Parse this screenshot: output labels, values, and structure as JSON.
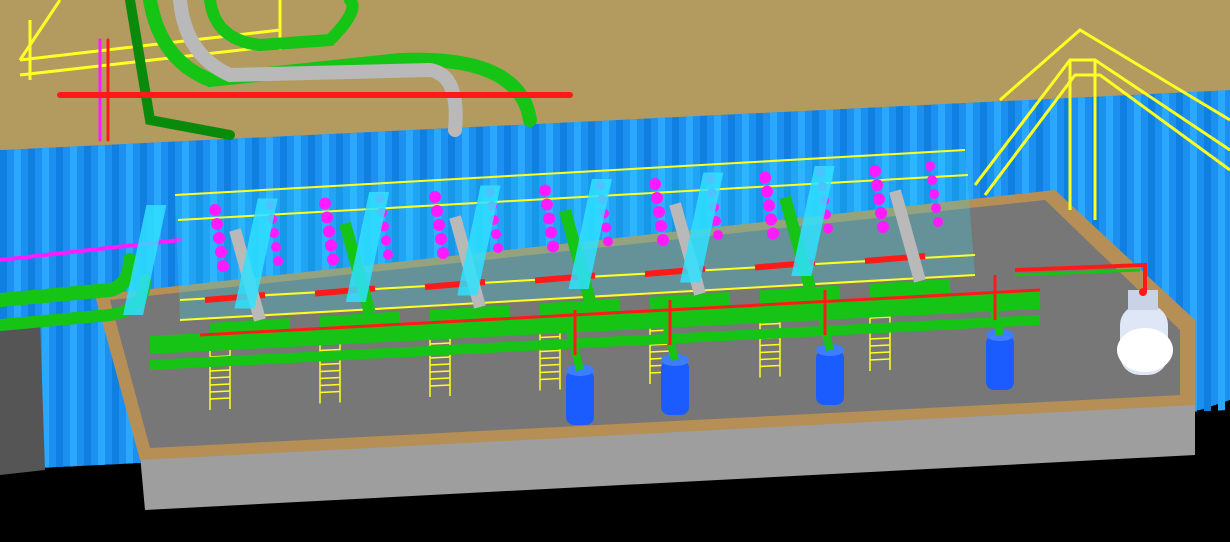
{
  "scene": {
    "description_free": true,
    "colors": {
      "ground": "#b39a5f",
      "water_light": "#2aa8ff",
      "water_dark": "#0f7fe0",
      "basin_floor": "#7a7a7a",
      "basin_wall": "#a0a0a0",
      "basin_rim": "#b58f55",
      "pipe_green": "#15c415",
      "pipe_dark_green": "#0a8a0a",
      "pipe_grey": "#b9b9b9",
      "pipe_red": "#ff1a1a",
      "pipe_magenta": "#ff1aff",
      "pipe_cyan": "#2fe0ff",
      "walkway_yellow": "#ffff22",
      "pump_blue": "#1a5cff",
      "tank_white": "#eef3ff",
      "background": "#000000"
    },
    "pump_count": 4,
    "icons": [
      "walkway-stair",
      "pump-motor",
      "pressure-tank"
    ]
  }
}
